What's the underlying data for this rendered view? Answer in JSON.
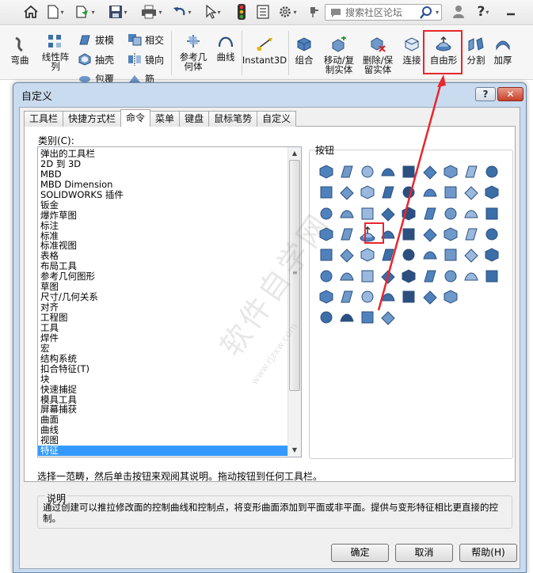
{
  "toolbar": {
    "search_placeholder": "搜索社区论坛",
    "help_symbol": "?",
    "icons": [
      "home-icon",
      "new-file-icon",
      "open-icon",
      "save-icon",
      "print-icon",
      "undo-icon",
      "select-pointer-icon",
      "traffic-light-icon",
      "file-properties-icon",
      "gear-icon",
      "pin-icon",
      "search-icon",
      "user-icon",
      "help-icon",
      "minimize-icon"
    ]
  },
  "ribbon": {
    "left_partial": "弯曲",
    "linear_pattern": "线性阵列",
    "extrude_boss": "拔模",
    "shell": "抽壳",
    "wrap": "包覆",
    "intersect": "相交",
    "mirror": "镜向",
    "rib_partial": "筋",
    "ref_geometry": "参考几何体",
    "curves": "曲线",
    "instant3d": "Instant3D",
    "combine": "组合",
    "move_copy": "移动/复制实体",
    "delete_keep": "删除/保留实体",
    "join": "连接",
    "freeform": "自由形",
    "split": "分割",
    "thicken": "加厚"
  },
  "dialog": {
    "title": "自定义",
    "help_btn": "?",
    "close_btn": "✕",
    "tabs": [
      {
        "label": "工具栏",
        "active": false
      },
      {
        "label": "快捷方式栏",
        "active": false
      },
      {
        "label": "命令",
        "active": true
      },
      {
        "label": "菜单",
        "active": false
      },
      {
        "label": "键盘",
        "active": false
      },
      {
        "label": "鼠标笔势",
        "active": false
      },
      {
        "label": "自定义",
        "active": false
      }
    ],
    "category_label": "类别(C):",
    "categories": [
      "弹出的工具栏",
      "2D 到 3D",
      "MBD",
      "MBD Dimension",
      "SOLIDWORKS 插件",
      "钣金",
      "爆炸草图",
      "标注",
      "标准",
      "标准视图",
      "表格",
      "布局工具",
      "参考几何图形",
      "草图",
      "尺寸/几何关系",
      "对齐",
      "工程图",
      "工具",
      "焊件",
      "宏",
      "结构系统",
      "扣合特征(T)",
      "块",
      "快速捕捉",
      "模具工具",
      "屏幕捕获",
      "曲面",
      "曲线",
      "视图",
      "特征"
    ],
    "selected_category": "特征",
    "buttons_label": "按钮",
    "hint": "选择一范畴，然后单击按钮来观阅其说明。拖动按钮到任何工具栏。",
    "description_title": "说明",
    "description": "通过创建可以推拉修改面的控制曲线和控制点，将变形曲面添加到平面或非平面。提供与变形特征相比更直接的控制。",
    "ok": "确定",
    "cancel": "取消",
    "help": "帮助(H)"
  },
  "colors": {
    "highlight": "#e8262e",
    "selection": "#3399ff",
    "dialog_frame": "#c9dbef"
  },
  "watermark": {
    "text": "软件自学网",
    "url": "www.rjzxw.com"
  }
}
